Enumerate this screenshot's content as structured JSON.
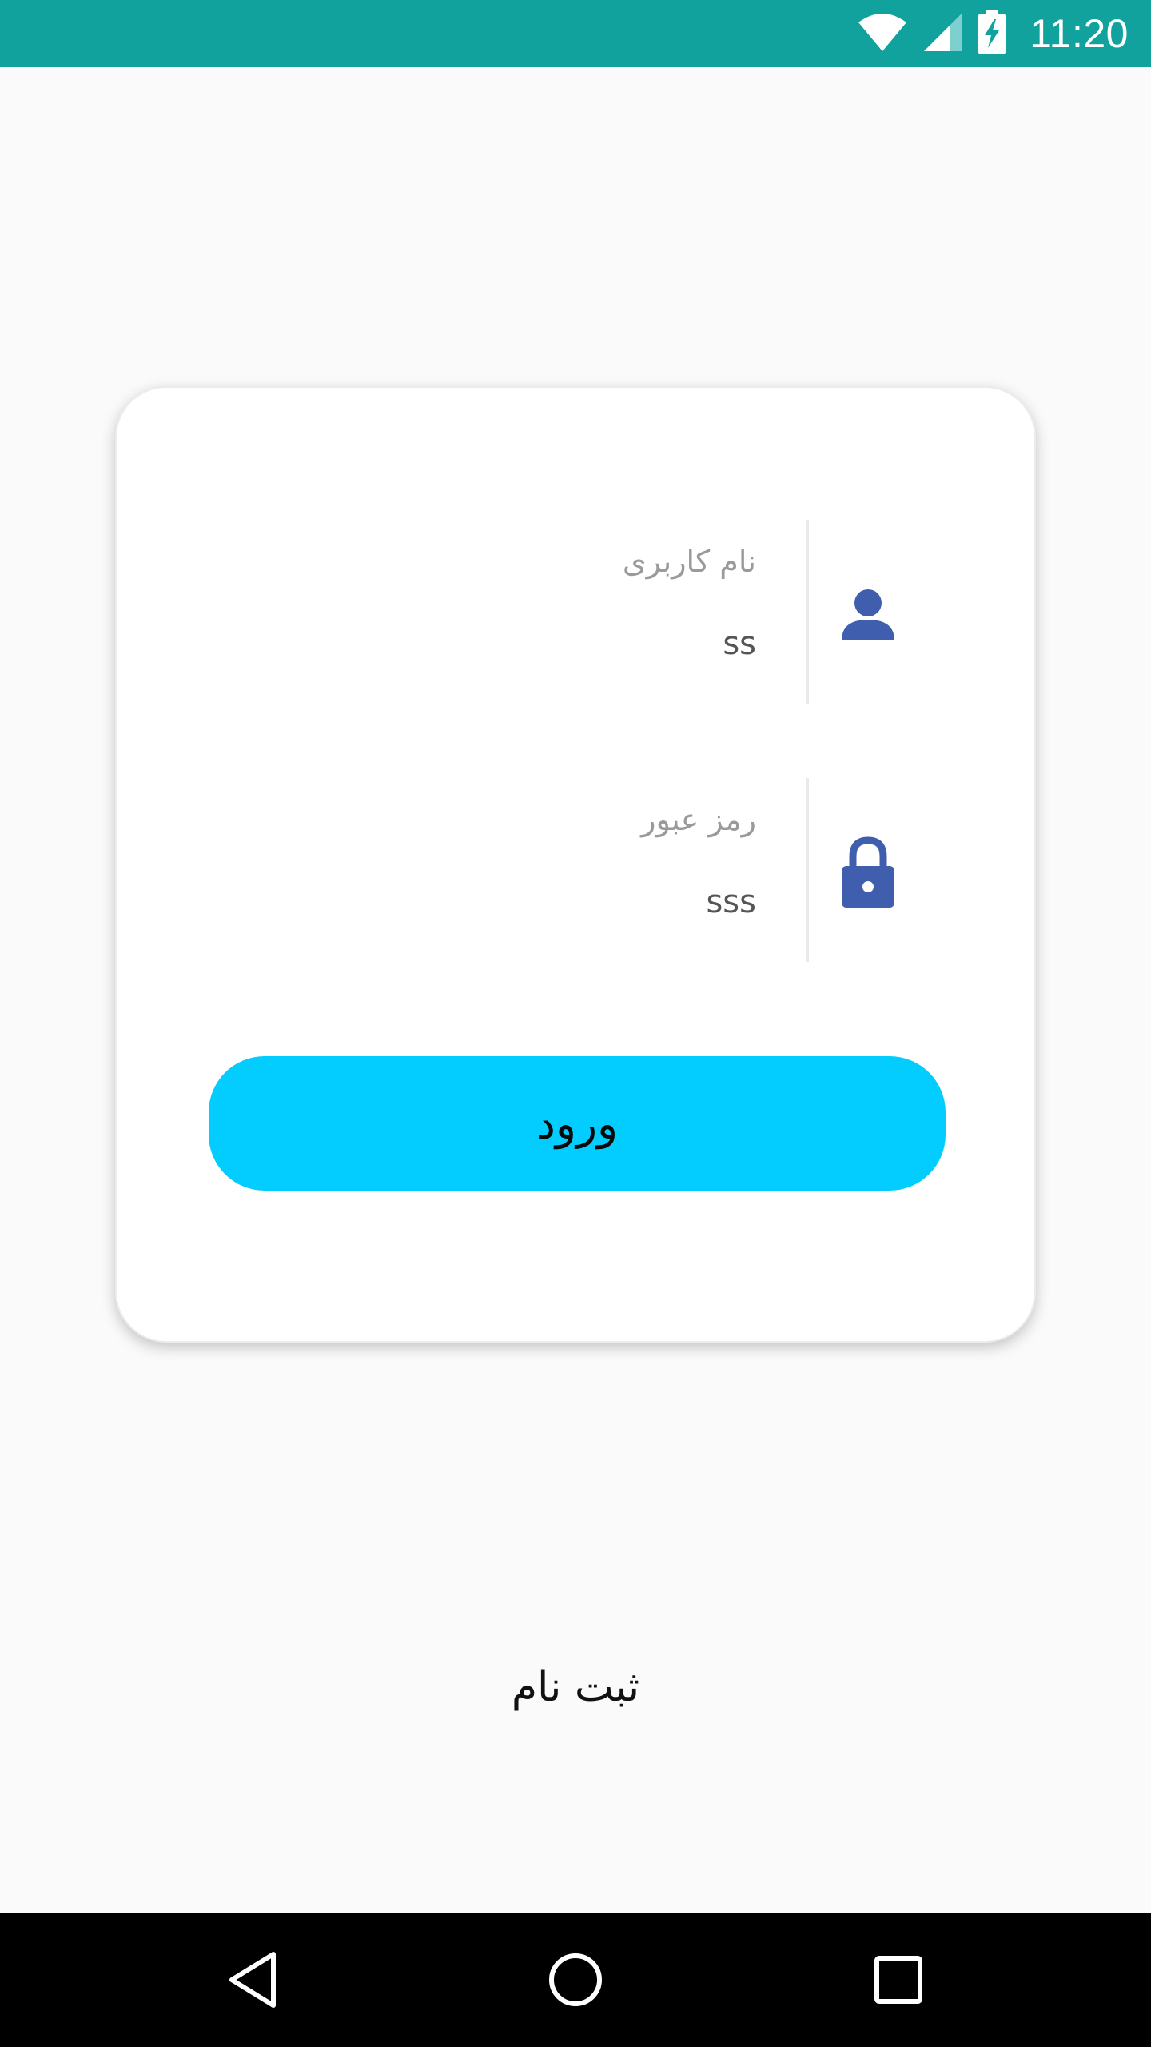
{
  "status_bar": {
    "time": "11:20",
    "icons": [
      "wifi-icon",
      "cellular-signal-icon",
      "battery-charging-icon"
    ]
  },
  "login_form": {
    "username": {
      "label": "نام کاربری",
      "value": "ss",
      "icon": "person-icon"
    },
    "password": {
      "label": "رمز عبور",
      "value": "sss",
      "icon": "lock-icon"
    },
    "submit_label": "ورود"
  },
  "register_label": "ثبت نام",
  "nav_bar": {
    "icons": [
      "back-icon",
      "home-icon",
      "recents-icon"
    ]
  },
  "colors": {
    "status_bar": "#12a29e",
    "button": "#03cdfe",
    "icon_blue": "#3f5fae",
    "background": "#fafafa"
  }
}
